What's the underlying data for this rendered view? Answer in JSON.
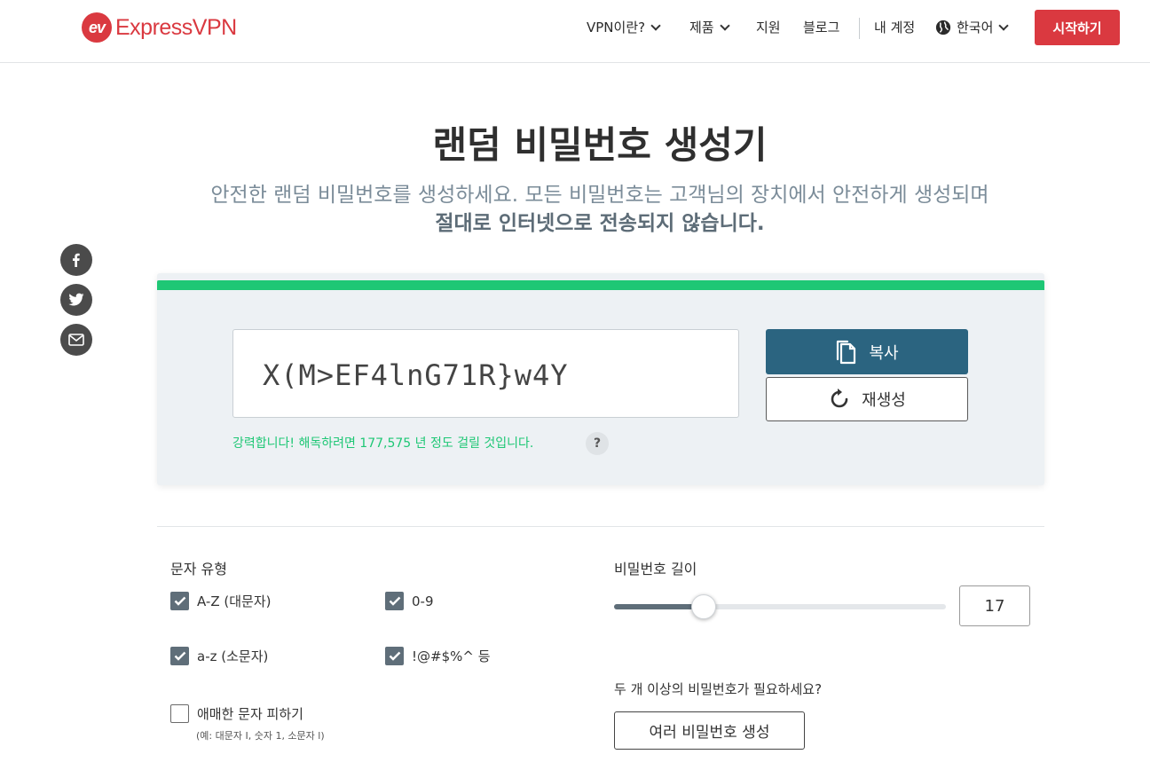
{
  "header": {
    "logo_mark": "ev",
    "logo_text": "ExpressVPN",
    "nav": {
      "what_is_vpn": "VPN이란?",
      "products": "제품",
      "support": "지원",
      "blog": "블로그",
      "my_account": "내 계정",
      "language": "한국어"
    },
    "start_button": "시작하기"
  },
  "page": {
    "title": "랜덤 비밀번호 생성기",
    "subtitle_line1": "안전한 랜덤 비밀번호를 생성하세요. 모든 비밀번호는 고객님의 장치에서 안전하게 생성되며",
    "subtitle_line2": "절대로 인터넷으로 전송되지 않습니다."
  },
  "social": [
    "facebook-icon",
    "twitter-icon",
    "email-icon"
  ],
  "generator": {
    "password": "X(M>EF4lnG71R}w4Y",
    "strength_fraction": 1.0,
    "strength_color": "#1ec775",
    "copy_label": "복사",
    "regenerate_label": "재생성",
    "strength_message": "강력합니다! 해독하려면 177,575 년 정도 걸릴 것입니다.",
    "help": "?"
  },
  "options": {
    "char_types_label": "문자 유형",
    "uppercase": {
      "label": "A-Z (대문자)",
      "checked": true
    },
    "digits": {
      "label": "0-9",
      "checked": true
    },
    "lowercase": {
      "label": "a-z (소문자)",
      "checked": true
    },
    "symbols": {
      "label": "!@#$%^ 등",
      "checked": true
    },
    "avoid_ambiguous": {
      "label": "애매한 문자 피하기",
      "checked": false
    },
    "avoid_note": "(예: 대문자 I, 숫자 1, 소문자 l)",
    "length_label": "비밀번호 길이",
    "length_value": "17",
    "length_slider_fraction": 0.27,
    "multiple_question": "두 개 이상의 비밀번호가 필요하세요?",
    "multiple_button": "여러 비밀번호 생성"
  },
  "colors": {
    "brand_red": "#da3940",
    "primary_blue": "#2b6480",
    "strength_green": "#1ec775"
  }
}
